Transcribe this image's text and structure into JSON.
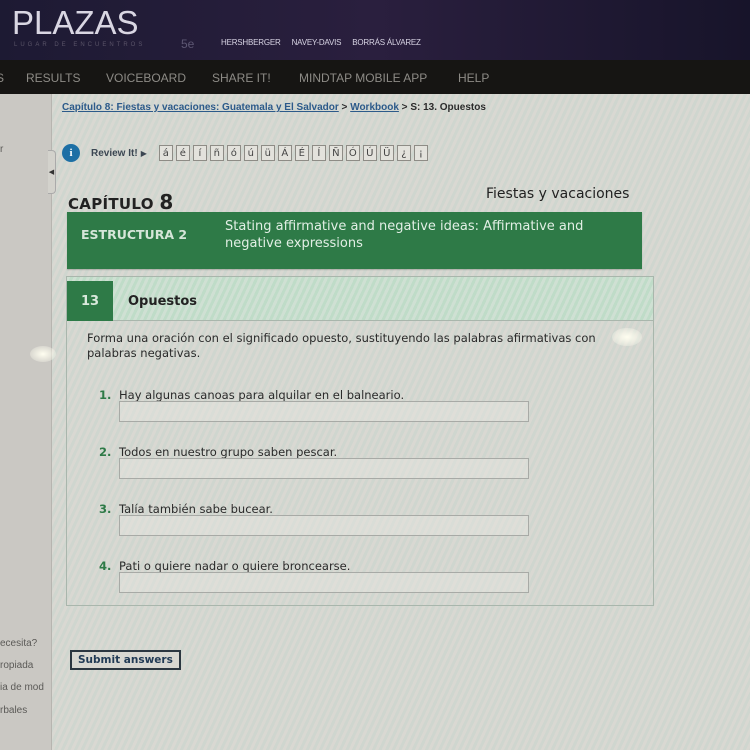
{
  "header": {
    "logo": "PLAZAS",
    "tagline": "LUGAR DE ENCUENTROS",
    "edition": "5e",
    "authors": [
      "HERSHBERGER",
      "NAVEY-DAVIS",
      "BORRÁS ÁLVAREZ"
    ]
  },
  "nav": {
    "items": [
      "S",
      "RESULTS",
      "VOICEBOARD",
      "SHARE IT!",
      "MINDTAP MOBILE APP",
      "HELP"
    ]
  },
  "sidebar": {
    "items": [
      "r",
      "ecesita?",
      "ropiada",
      "ia de mod",
      "rbales"
    ]
  },
  "breadcrumb": {
    "chapter_link": "Capítulo 8: Fiestas y vacaciones: Guatemala y El Salvador",
    "sep1": " > ",
    "workbook_link": "Workbook",
    "sep2": " > ",
    "current": "S: 13. Opuestos"
  },
  "review": {
    "label": "Review It!",
    "info_icon": "i",
    "arrow": "▶",
    "characters": [
      "á",
      "é",
      "í",
      "ñ",
      "ó",
      "ú",
      "ü",
      "Á",
      "É",
      "Í",
      "Ñ",
      "Ó",
      "Ú",
      "Ü",
      "¿",
      "¡"
    ]
  },
  "chapter": {
    "label": "CAPÍTULO",
    "number": "8",
    "subtitle": "Fiestas y vacaciones"
  },
  "estructura": {
    "label": "ESTRUCTURA 2",
    "description": "Stating affirmative and negative ideas: Affirmative and negative expressions"
  },
  "exercise": {
    "number": "13",
    "title": "Opuestos",
    "instructions": "Forma una oración con el significado opuesto, sustituyendo las palabras afirmativas con palabras negativas.",
    "questions": [
      {
        "num": "1.",
        "text": "Hay algunas canoas para alquilar en el balneario.",
        "answer": ""
      },
      {
        "num": "2.",
        "text": "Todos en nuestro grupo saben pescar.",
        "answer": ""
      },
      {
        "num": "3.",
        "text": "Talía también sabe bucear.",
        "answer": ""
      },
      {
        "num": "4.",
        "text": "Pati o quiere nadar o quiere broncearse.",
        "answer": ""
      }
    ]
  },
  "submit": {
    "label": "Submit answers"
  },
  "colors": {
    "header_bg": "#1d1a33",
    "nav_bg": "#161513",
    "accent_green": "#2e7a47",
    "link_blue": "#2c5a8a",
    "info_blue": "#1d6fa5"
  }
}
